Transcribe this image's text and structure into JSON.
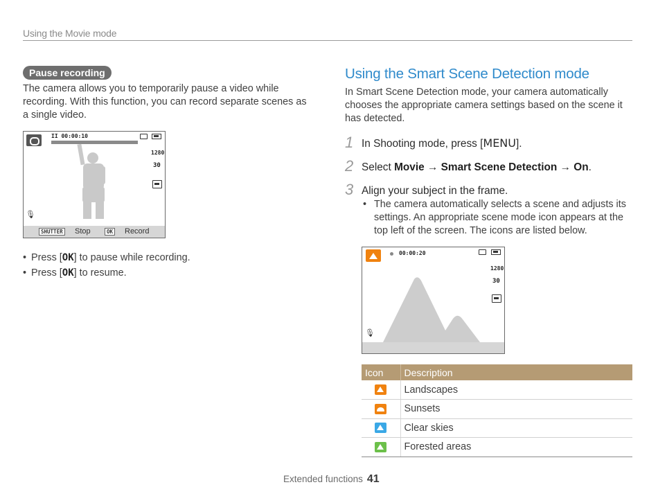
{
  "header": {
    "running_head": "Using the Movie mode"
  },
  "left": {
    "pill": "Pause recording",
    "para": "The camera allows you to temporarily pause a video while recording. With this function, you can record separate scenes as a single video.",
    "screen": {
      "pause_time": "II 00:00:10",
      "res": "1280",
      "fps": "30",
      "shutter_key": "SHUTTER",
      "shutter_label": "Stop",
      "ok_key": "OK",
      "ok_label": "Record"
    },
    "bullets": [
      {
        "pre": "Press [",
        "key": "OK",
        "post": "] to pause while recording."
      },
      {
        "pre": "Press [",
        "key": "OK",
        "post": "] to resume."
      }
    ]
  },
  "right": {
    "title": "Using the Smart Scene Detection mode",
    "para": "In Smart Scene Detection mode, your camera automatically chooses the appropriate camera settings based on the scene it has detected.",
    "steps": [
      {
        "num": "1",
        "pre": "In Shooting mode, press [",
        "key": "MENU",
        "post": "]."
      },
      {
        "num": "2",
        "pre": "Select ",
        "bold1": "Movie",
        "arrow1": " → ",
        "bold2": "Smart Scene Detection",
        "arrow2": " → ",
        "bold3": "On",
        "post": "."
      },
      {
        "num": "3",
        "text": "Align your subject in the frame."
      }
    ],
    "sub_bullet": "The camera automatically selects a scene and adjusts its settings. An appropriate scene mode icon appears at the top left of the screen. The icons are listed below.",
    "screen": {
      "time": "00:00:20",
      "res": "1280",
      "fps": "30"
    },
    "table": {
      "headers": [
        "Icon",
        "Description"
      ],
      "rows": [
        {
          "icon": "landscape-icon",
          "color": "#f0820f",
          "desc": "Landscapes"
        },
        {
          "icon": "sunset-icon",
          "color": "#f0820f",
          "desc": "Sunsets"
        },
        {
          "icon": "clear-sky-icon",
          "color": "#3aa8e6",
          "desc": "Clear skies"
        },
        {
          "icon": "forest-icon",
          "color": "#6cc04a",
          "desc": "Forested areas"
        }
      ]
    }
  },
  "footer": {
    "section": "Extended functions",
    "page": "41"
  }
}
